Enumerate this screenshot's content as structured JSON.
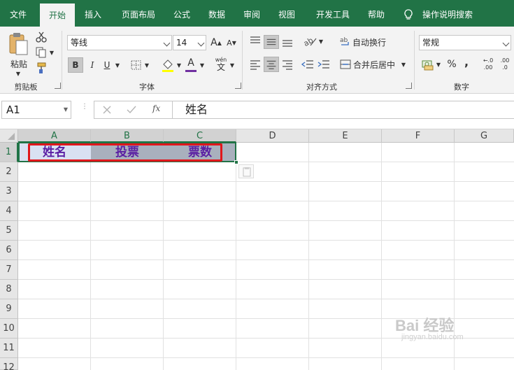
{
  "tabs": [
    {
      "label": "文件"
    },
    {
      "label": "开始"
    },
    {
      "label": "插入"
    },
    {
      "label": "页面布局"
    },
    {
      "label": "公式"
    },
    {
      "label": "数据"
    },
    {
      "label": "审阅"
    },
    {
      "label": "视图"
    },
    {
      "label": "开发工具"
    },
    {
      "label": "帮助"
    }
  ],
  "active_tab": "开始",
  "tell_me": "操作说明搜索",
  "ribbon": {
    "clipboard": {
      "paste_label": "粘贴",
      "group_label": "剪贴板"
    },
    "font": {
      "font_name": "等线",
      "font_size": "14",
      "bold": "B",
      "italic": "I",
      "underline": "U",
      "font_color_letter": "A",
      "phonetic_top": "wén",
      "phonetic_bottom": "文",
      "group_label": "字体",
      "grow_letter": "A",
      "shrink_letter": "A"
    },
    "alignment": {
      "wrap_text": "自动换行",
      "merge_center": "合并后居中",
      "group_label": "对齐方式"
    },
    "number": {
      "format": "常规",
      "percent": "%",
      "comma": ",",
      "inc_decimal": ".00",
      "dec_decimal": ".0",
      "group_label": "数字"
    }
  },
  "formula_bar": {
    "name_box": "A1",
    "fx": "fx",
    "content": "姓名"
  },
  "columns": [
    "A",
    "B",
    "C",
    "D",
    "E",
    "F",
    "G"
  ],
  "rows": [
    "1",
    "2",
    "3",
    "4",
    "5",
    "6",
    "7",
    "8",
    "9",
    "10",
    "11",
    "12"
  ],
  "cells": {
    "A1": "姓名",
    "B1": "投票",
    "C1": "票数"
  },
  "watermark": {
    "text": "Bai 经验",
    "url": "jingyan.baidu.com"
  },
  "colors": {
    "ribbon_green": "#217346",
    "cell_text": "#5a1ea3",
    "highlight_box": "#e0161b",
    "font_color_bar": "#7030a0",
    "fill_color_bar": "#ffff00"
  }
}
